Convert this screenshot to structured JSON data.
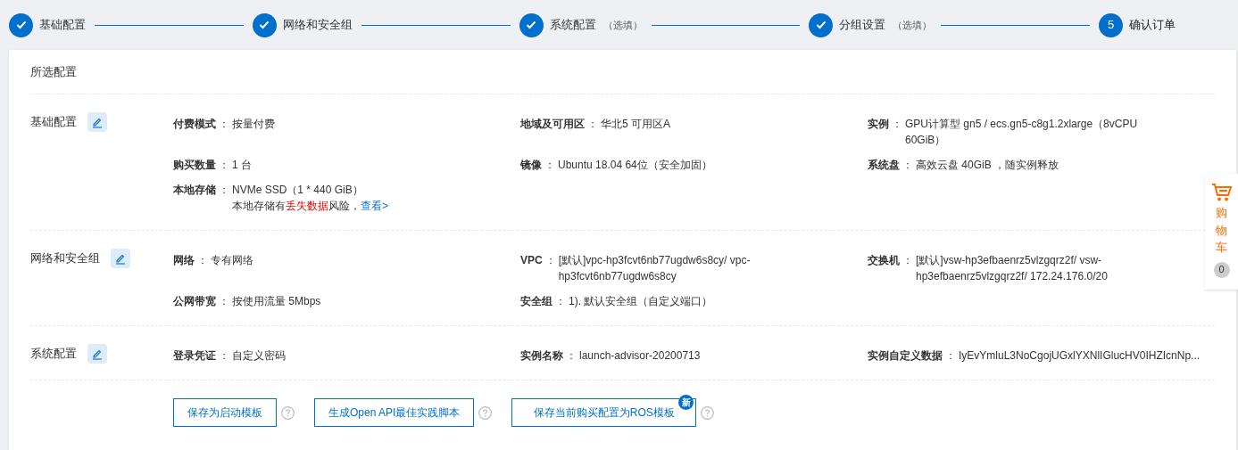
{
  "steps": [
    {
      "label": "基础配置",
      "done": true
    },
    {
      "label": "网络和安全组",
      "done": true
    },
    {
      "label": "系统配置",
      "note": "（选填）",
      "done": true
    },
    {
      "label": "分组设置",
      "note": "（选填）",
      "done": true
    },
    {
      "label": "确认订单",
      "number": "5",
      "done": false
    }
  ],
  "card_title": "所选配置",
  "sections": [
    {
      "title": "基础配置",
      "fields": [
        {
          "label": "付费模式",
          "value": "按量付费"
        },
        {
          "label": "地域及可用区",
          "value": "华北5 可用区A"
        },
        {
          "label": "实例",
          "value": "GPU计算型 gn5 / ecs.gn5-c8g1.2xlarge（8vCPU 60GiB）"
        },
        {
          "label": "购买数量",
          "value": "1 台"
        },
        {
          "label": "镜像",
          "value": "Ubuntu 18.04 64位（安全加固）"
        },
        {
          "label": "系统盘",
          "value": "高效云盘 40GiB ，随实例释放"
        },
        {
          "label": "本地存储",
          "value": "NVMe SSD（1 * 440 GiB）",
          "note": {
            "before": "本地存储有",
            "warning": "丢失数据",
            "after": "风险，",
            "link": "查看>"
          }
        }
      ]
    },
    {
      "title": "网络和安全组",
      "fields": [
        {
          "label": "网络",
          "value": "专有网络"
        },
        {
          "label": "VPC",
          "value": "[默认]vpc-hp3fcvt6nb77ugdw6s8cy/ vpc-hp3fcvt6nb77ugdw6s8cy"
        },
        {
          "label": "交换机",
          "value": "[默认]vsw-hp3efbaenrz5vlzgqrz2f/ vsw-hp3efbaenrz5vlzgqrz2f/ 172.24.176.0/20"
        },
        {
          "label": "公网带宽",
          "value": "按使用流量 5Mbps"
        },
        {
          "label": "安全组",
          "value": "1). 默认安全组（自定义端口）"
        }
      ]
    },
    {
      "title": "系统配置",
      "fields": [
        {
          "label": "登录凭证",
          "value": "自定义密码"
        },
        {
          "label": "实例名称",
          "value": "launch-advisor-20200713"
        },
        {
          "label": "实例自定义数据",
          "value": "IyEvYmluL3NoCgojUGxlYXNlIGlucHV0IHZIcnNp..."
        }
      ]
    }
  ],
  "separator": "：",
  "actions": [
    {
      "label": "保存为启动模板"
    },
    {
      "label": "生成Open API最佳实践脚本"
    },
    {
      "label": "保存当前购买配置为ROS模板",
      "badge": "新"
    }
  ],
  "cart": {
    "label": "购物车",
    "count": "0"
  }
}
